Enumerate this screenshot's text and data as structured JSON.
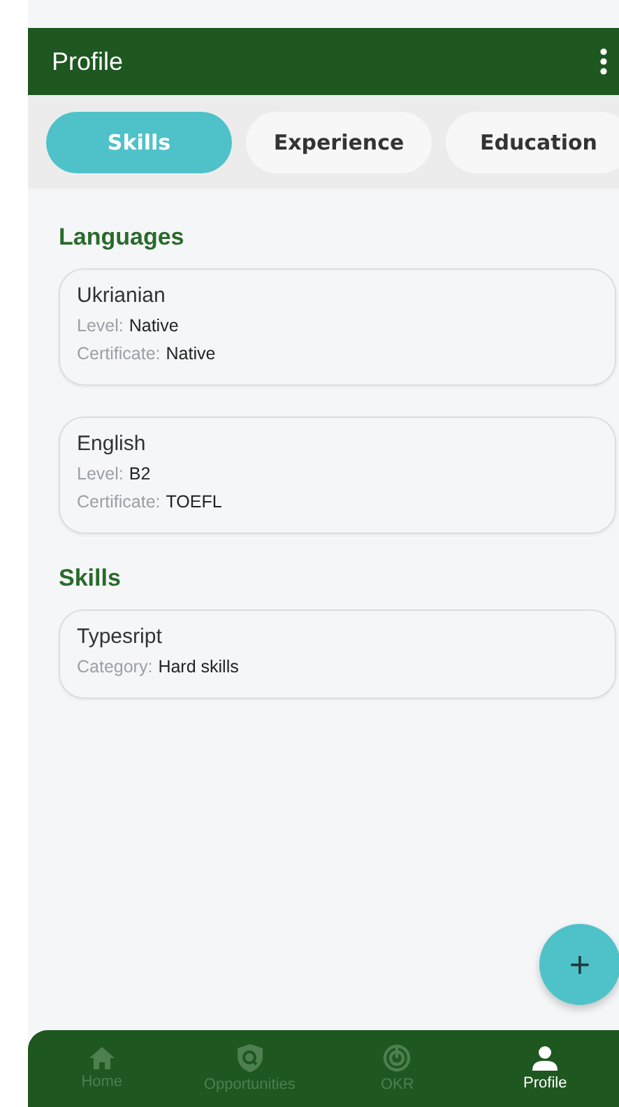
{
  "app_bar": {
    "title": "Profile"
  },
  "tabs": [
    {
      "label": "Skills",
      "selected": true
    },
    {
      "label": "Experience",
      "selected": false
    },
    {
      "label": "Education",
      "selected": false
    }
  ],
  "sections": [
    {
      "title": "Languages",
      "cards": [
        {
          "name": "Ukrianian",
          "fields": [
            {
              "label": "Level:",
              "value": "Native"
            },
            {
              "label": "Certificate:",
              "value": "Native"
            }
          ]
        },
        {
          "name": "English",
          "fields": [
            {
              "label": "Level:",
              "value": "B2"
            },
            {
              "label": "Certificate:",
              "value": "TOEFL"
            }
          ]
        }
      ]
    },
    {
      "title": "Skills",
      "cards": [
        {
          "name": "Typesript",
          "fields": [
            {
              "label": "Category:",
              "value": "Hard skills"
            }
          ]
        }
      ]
    }
  ],
  "fab": {
    "label": "+"
  },
  "bottom_nav": [
    {
      "kind": "home",
      "label": "Home",
      "selected": false
    },
    {
      "kind": "opportunities",
      "label": "Opportunities",
      "selected": false
    },
    {
      "kind": "okr",
      "label": "OKR",
      "selected": false
    },
    {
      "kind": "profile",
      "label": "Profile",
      "selected": true
    }
  ]
}
